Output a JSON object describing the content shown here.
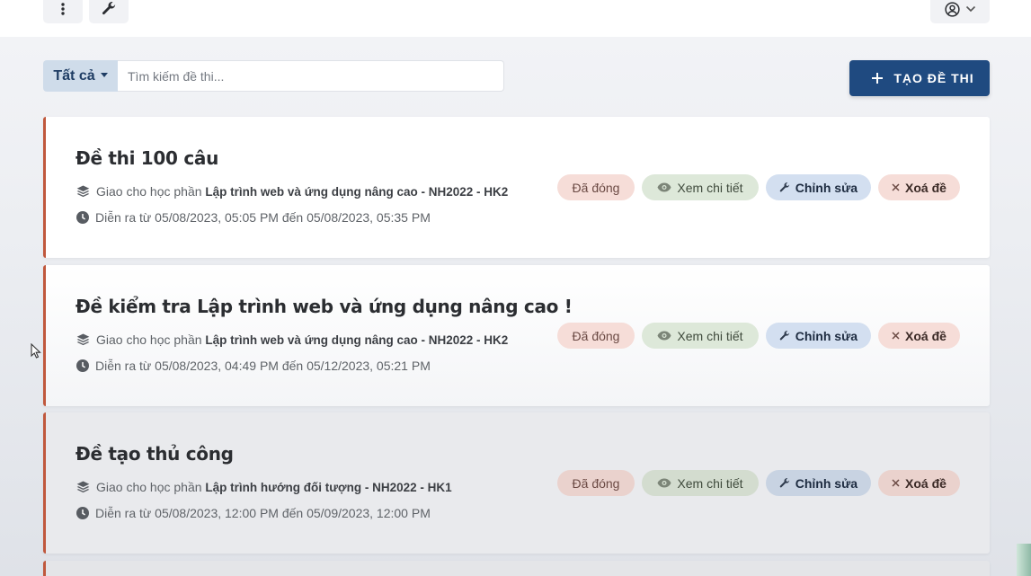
{
  "toolbar": {
    "more_icon": "kebab-vertical-icon",
    "tools_icon": "wrench-icon",
    "user_icon": "user-circle-icon"
  },
  "filter": {
    "selected": "Tất cả",
    "search_placeholder": "Tìm kiếm đề thi..."
  },
  "create_button": {
    "icon": "plus",
    "label": "TẠO ĐỀ THI"
  },
  "exams": [
    {
      "title": "Đề thi 100 câu",
      "assigned_prefix": "Giao cho học phần",
      "course": "Lập trình web và ứng dụng nâng cao - NH2022 - HK2",
      "time_text": "Diễn ra từ 05/08/2023, 05:05 PM đến 05/08/2023, 05:35 PM",
      "status": "Đã đóng",
      "view_label": "Xem chi tiết",
      "edit_label": "Chỉnh sửa",
      "delete_label": "Xoá đề"
    },
    {
      "title": "Đề kiểm tra Lập trình web và ứng dụng nâng cao !",
      "assigned_prefix": "Giao cho học phần",
      "course": "Lập trình web và ứng dụng nâng cao - NH2022 - HK2",
      "time_text": "Diễn ra từ 05/08/2023, 04:49 PM đến 05/12/2023, 05:21 PM",
      "status": "Đã đóng",
      "view_label": "Xem chi tiết",
      "edit_label": "Chỉnh sửa",
      "delete_label": "Xoá đề"
    },
    {
      "title": "Đề tạo thủ công",
      "assigned_prefix": "Giao cho học phần",
      "course": "Lập trình hướng đối tượng - NH2022 - HK1",
      "time_text": "Diễn ra từ 05/08/2023, 12:00 PM đến 05/09/2023, 12:00 PM",
      "status": "Đã đóng",
      "view_label": "Xem chi tiết",
      "edit_label": "Chỉnh sửa",
      "delete_label": "Xoá đề"
    }
  ],
  "colors": {
    "primary": "#1f4a80",
    "card_accent": "#c0583d",
    "status_bg": "#f6ddd8",
    "view_bg": "#dde8d9",
    "edit_bg": "#d3dff0"
  }
}
